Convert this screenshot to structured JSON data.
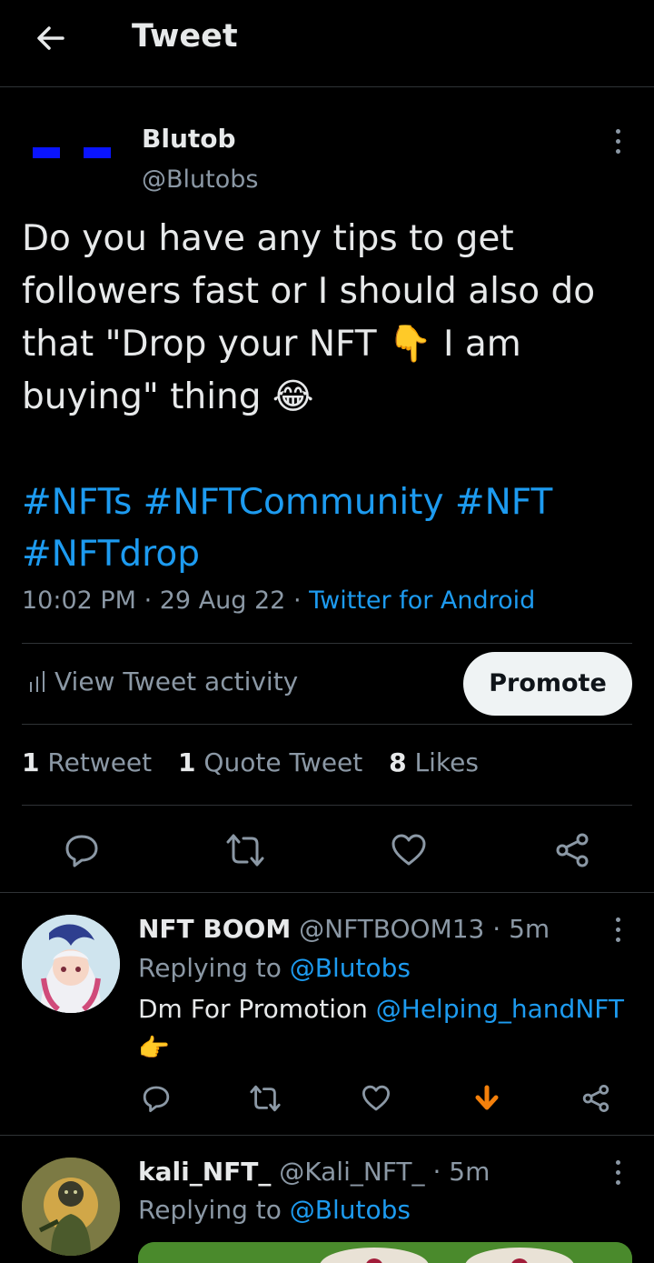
{
  "header": {
    "title": "Tweet",
    "back_icon": "arrow-left-icon"
  },
  "tweet": {
    "author_name": "Blutob",
    "author_handle": "@Blutobs",
    "text": "Do you have any tips to get followers fast or I should also do that \"Drop your NFT 👇 I am buying\" thing 😂",
    "hashtags": "#NFTs #NFTCommunity #NFT #NFTdrop",
    "time": "10:02 PM",
    "date": "29 Aug 22",
    "source": "Twitter for Android",
    "activity_label": "View Tweet activity",
    "promote_label": "Promote",
    "retweet_count": "1",
    "retweet_label": "Retweet",
    "quote_count": "1",
    "quote_label": "Quote Tweet",
    "likes_count": "8",
    "likes_label": "Likes"
  },
  "replies": [
    {
      "name": "NFT BOOM",
      "handle": "@NFTBOOM13",
      "time": "5m",
      "replying_prefix": "Replying to",
      "replying_to": "@Blutobs",
      "text_prefix": "Dm For Promotion",
      "mention": "@Helping_handNFT",
      "emoji": "👉"
    },
    {
      "name": "kali_NFT_",
      "handle": "@Kali_NFT_",
      "time": "5m",
      "replying_prefix": "Replying to",
      "replying_to": "@Blutobs"
    }
  ],
  "colors": {
    "accent": "#1d9bf0",
    "muted": "#8b98a5",
    "boost": "#f4800b"
  }
}
